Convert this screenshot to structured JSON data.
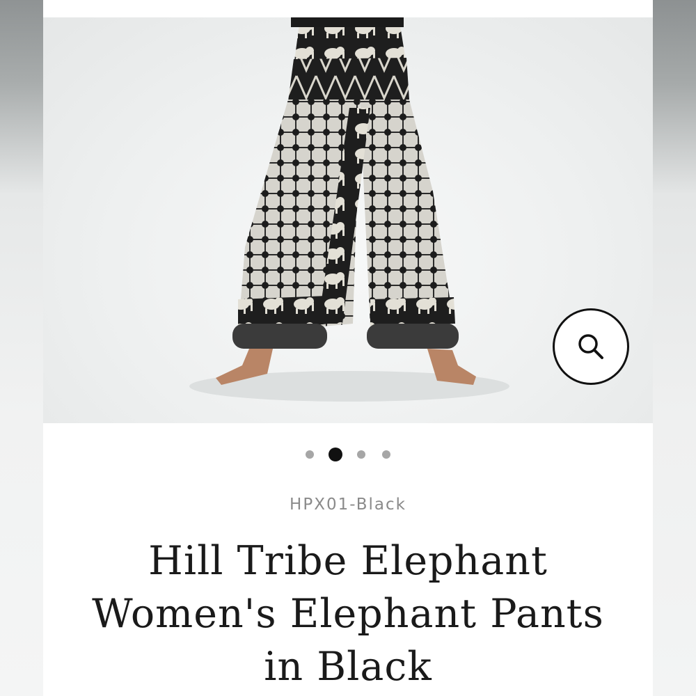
{
  "product": {
    "sku": "HPX01-Black",
    "title": "Hill Tribe Elephant Women's Elephant Pants in Black",
    "image_alt": "Hill Tribe Elephant Women's Elephant Pants in Black"
  },
  "carousel": {
    "total": 4,
    "active_index": 1
  },
  "icons": {
    "zoom": "magnifier-icon"
  },
  "colors": {
    "text_dark": "#1a1a1a",
    "text_muted": "#8a8a8a",
    "dot_inactive": "#a6a6a6",
    "dot_active": "#111111",
    "fabric_dark": "#1e1e1e",
    "fabric_light": "#d9d7d0"
  }
}
